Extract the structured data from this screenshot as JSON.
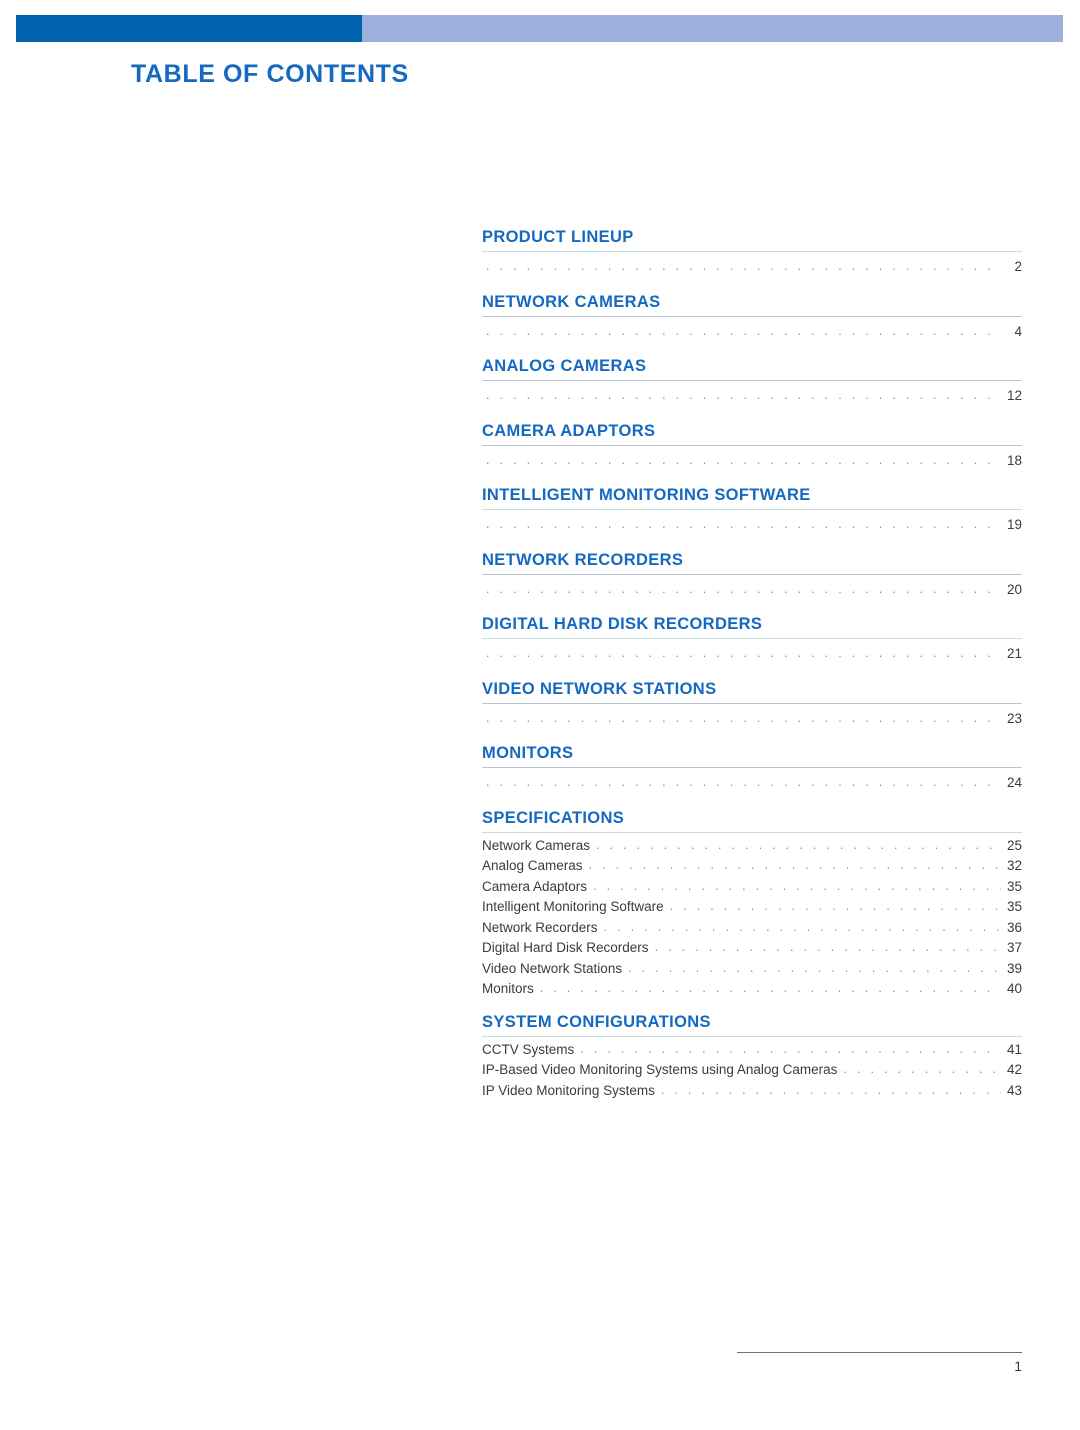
{
  "document": {
    "title": "TABLE OF CONTENTS",
    "footer_page_number": "1"
  },
  "theme": {
    "heading_blue": "#1569c0",
    "bar_dark_blue": "#0063b0",
    "bar_light_blue": "#9cb2dc",
    "rule_gray": "#b9c3d4",
    "rule_teal": "#c3dedd",
    "body_text": "#3b3b3b",
    "leader_dots": "#8a8a8a"
  },
  "toc": {
    "sections": [
      {
        "heading": "PRODUCT LINEUP",
        "page": "2",
        "rule_tint": "teal",
        "entries": []
      },
      {
        "heading": "NETWORK CAMERAS",
        "page": "4",
        "rule_tint": "gray",
        "entries": []
      },
      {
        "heading": "ANALOG CAMERAS",
        "page": "12",
        "rule_tint": "gray",
        "entries": []
      },
      {
        "heading": "CAMERA ADAPTORS",
        "page": "18",
        "rule_tint": "gray",
        "entries": []
      },
      {
        "heading": "INTELLIGENT MONITORING SOFTWARE",
        "page": "19",
        "rule_tint": "teal",
        "entries": []
      },
      {
        "heading": "NETWORK RECORDERS",
        "page": "20",
        "rule_tint": "gray",
        "entries": []
      },
      {
        "heading": "DIGITAL HARD DISK RECORDERS",
        "page": "21",
        "rule_tint": "teal",
        "entries": []
      },
      {
        "heading": "VIDEO NETWORK STATIONS",
        "page": "23",
        "rule_tint": "gray",
        "entries": []
      },
      {
        "heading": "MONITORS",
        "page": "24",
        "rule_tint": "gray",
        "entries": []
      },
      {
        "heading": "SPECIFICATIONS",
        "page": null,
        "rule_tint": "teal",
        "entries": [
          {
            "label": "Network Cameras",
            "page": "25"
          },
          {
            "label": "Analog Cameras",
            "page": "32"
          },
          {
            "label": "Camera Adaptors",
            "page": "35"
          },
          {
            "label": "Intelligent Monitoring Software",
            "page": "35"
          },
          {
            "label": "Network Recorders",
            "page": "36"
          },
          {
            "label": "Digital Hard Disk Recorders",
            "page": "37"
          },
          {
            "label": "Video Network Stations",
            "page": "39"
          },
          {
            "label": "Monitors",
            "page": "40"
          }
        ]
      },
      {
        "heading": "SYSTEM CONFIGURATIONS",
        "page": null,
        "rule_tint": "teal",
        "entries": [
          {
            "label": "CCTV Systems",
            "page": "41"
          },
          {
            "label": "IP-Based Video Monitoring Systems using Analog Cameras",
            "page": "42"
          },
          {
            "label": "IP Video Monitoring Systems",
            "page": "43"
          }
        ]
      }
    ]
  }
}
